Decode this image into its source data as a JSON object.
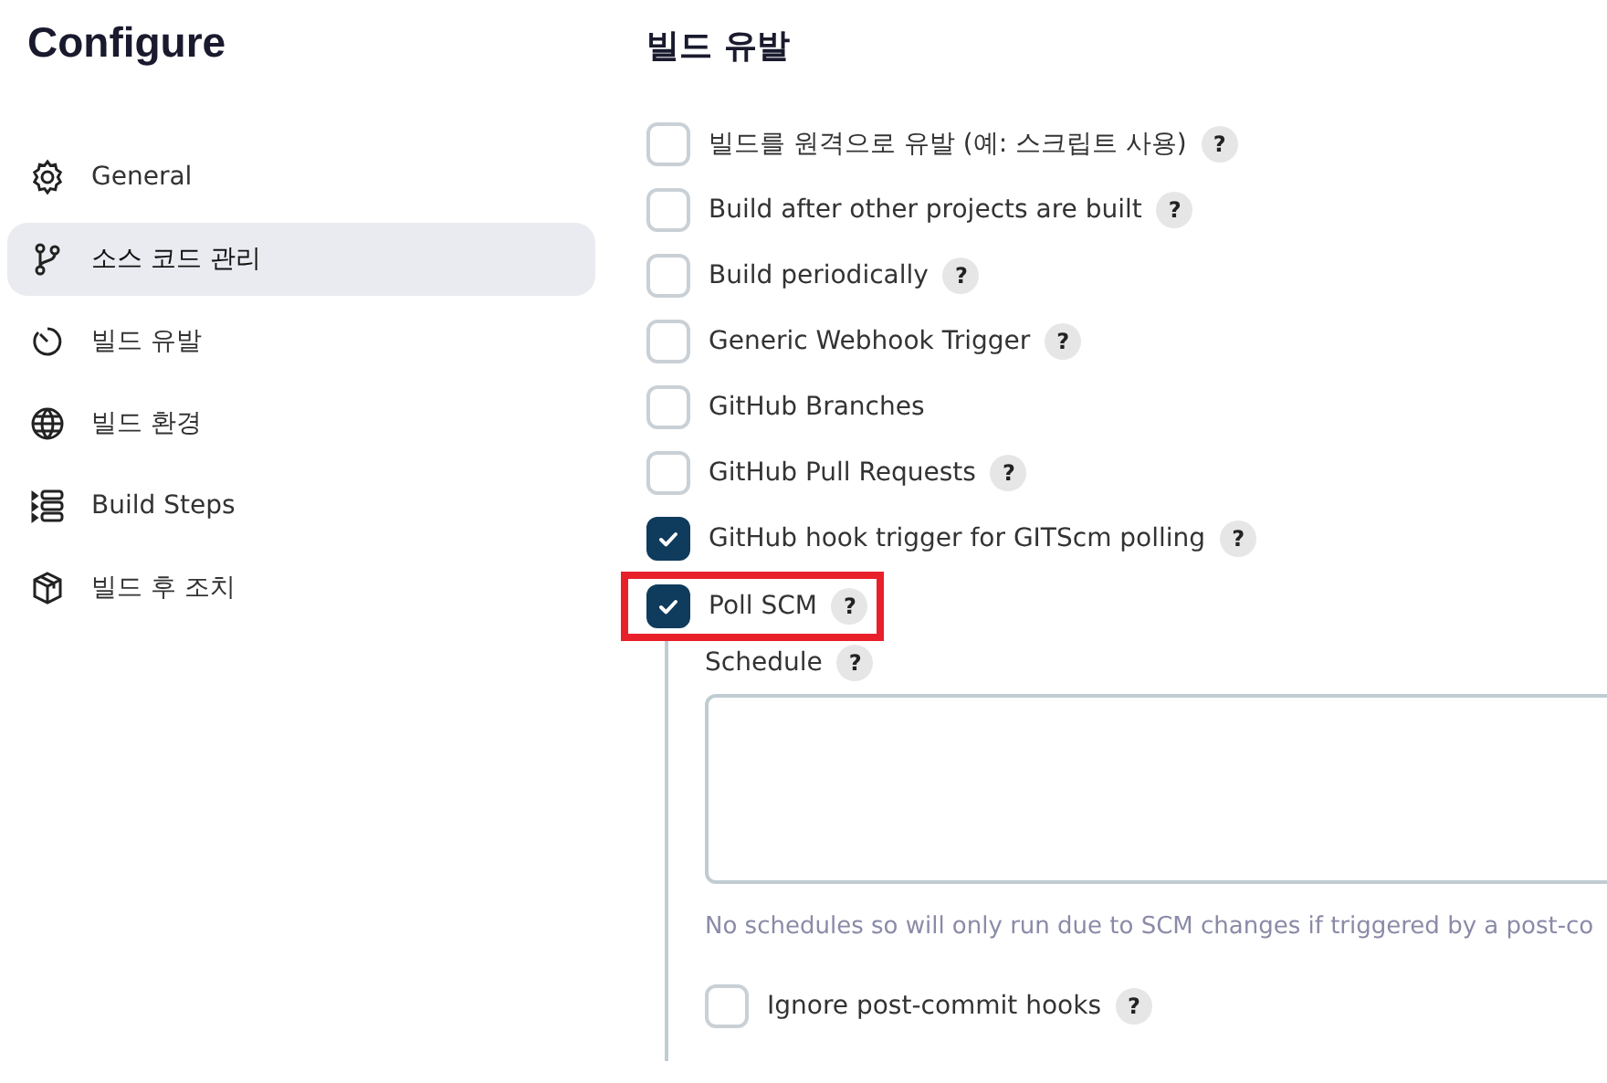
{
  "sidebar": {
    "title": "Configure",
    "items": [
      {
        "label": "General",
        "selected": false
      },
      {
        "label": "소스 코드 관리",
        "selected": true
      },
      {
        "label": "빌드 유발",
        "selected": false
      },
      {
        "label": "빌드 환경",
        "selected": false
      },
      {
        "label": "Build Steps",
        "selected": false
      },
      {
        "label": "빌드 후 조치",
        "selected": false
      }
    ]
  },
  "section": {
    "title": "빌드 유발",
    "triggers": [
      {
        "label": "빌드를 원격으로 유발 (예: 스크립트 사용)",
        "checked": false,
        "help": "?",
        "highlighted": false
      },
      {
        "label": "Build after other projects are built",
        "checked": false,
        "help": "?",
        "highlighted": false
      },
      {
        "label": "Build periodically",
        "checked": false,
        "help": "?",
        "highlighted": false
      },
      {
        "label": "Generic Webhook Trigger",
        "checked": false,
        "help": "?",
        "highlighted": false
      },
      {
        "label": "GitHub Branches",
        "checked": false,
        "highlighted": false
      },
      {
        "label": "GitHub Pull Requests",
        "checked": false,
        "help": "?",
        "highlighted": false
      },
      {
        "label": "GitHub hook trigger for GITScm polling",
        "checked": true,
        "help": "?",
        "highlighted": false
      },
      {
        "label": "Poll SCM",
        "checked": true,
        "help": "?",
        "highlighted": true
      }
    ],
    "poll_scm": {
      "schedule_label": "Schedule",
      "schedule_help": "?",
      "hint": "No schedules so will only run due to SCM changes if triggered by a post-co",
      "ignore_hooks": {
        "label": "Ignore post-commit hooks",
        "checked": false,
        "help": "?"
      }
    }
  }
}
